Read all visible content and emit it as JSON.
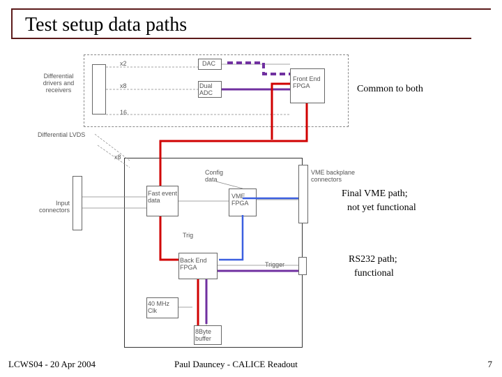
{
  "slide": {
    "title": "Test setup data paths",
    "page_number": "7"
  },
  "annotations": {
    "common": "Common to both",
    "vme_line1": "Final VME path;",
    "vme_line2": "not yet functional",
    "rs232_line1": "RS232 path;",
    "rs232_line2": "functional"
  },
  "diagram_labels": {
    "diff_drivers": "Differential drivers and receivers",
    "dac": "DAC",
    "dual_adc": "Dual ADC",
    "front_end_fpga": "Front End FPGA",
    "diff_lvds": "Differential LVDS",
    "x2": "x2",
    "x8": "x8",
    "x16": "16",
    "input_connectors": "Input connectors",
    "fast_event_data": "Fast event data",
    "config_data": "Config data",
    "vme_fpga": "VME FPGA",
    "backplane": "VME backplane connectors",
    "trig": "Trig",
    "backend_fpga": "Back End FPGA",
    "trigger": "Trigger",
    "clk": "40 MHz Clk",
    "buffer": "8Byte buffer",
    "x8_top": "x8"
  },
  "footer": {
    "left": "LCWS04 - 20 Apr 2004",
    "center": "Paul Dauncey - CALICE Readout"
  }
}
